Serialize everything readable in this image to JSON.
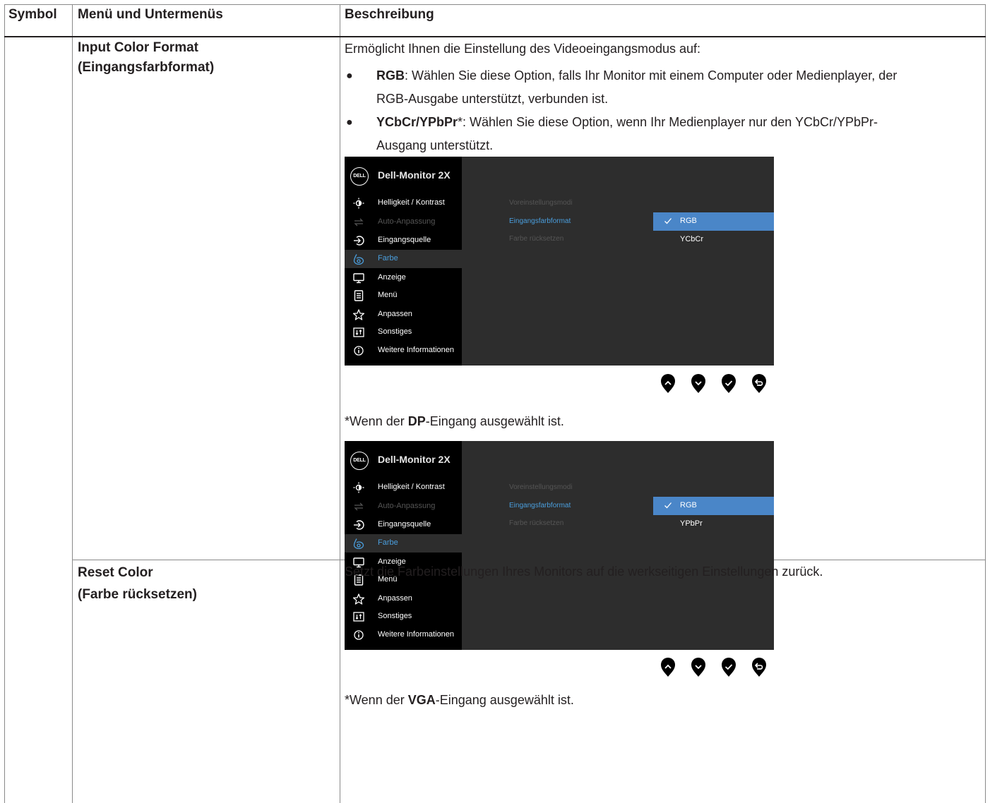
{
  "header": {
    "symbol": "Symbol",
    "menu": "Menü und Untermenüs",
    "description": "Beschreibung"
  },
  "row1": {
    "title_line1": "Input Color Format",
    "title_line2": "(Eingangsfarbformat)",
    "intro": "Ermöglicht Ihnen die Einstellung des Videoeingangsmodus auf:",
    "bullet1_bold": "RGB",
    "bullet1_line1": ": Wählen Sie diese Option, falls Ihr Monitor mit einem Computer oder Medienplayer, der",
    "bullet1_line2": "RGB-Ausgabe unterstützt, verbunden ist.",
    "bullet2_bold": "YCbCr/YPbPr",
    "bullet2_line1": "*: Wählen Sie diese Option, wenn Ihr Medienplayer nur den YCbCr/YPbPr-",
    "bullet2_line2": "Ausgang unterstützt.",
    "note1_prefix": "*Wenn der ",
    "note1_bold": "DP",
    "note1_suffix": "-Eingang ausgewählt ist.",
    "note2_prefix": "*Wenn der ",
    "note2_bold": "VGA",
    "note2_suffix": "-Eingang ausgewählt ist."
  },
  "row2": {
    "title_line1": "Reset Color",
    "title_line2": "(Farbe rücksetzen)",
    "desc": "Setzt die Farbeinstellungen Ihres Monitors auf die werkseitigen Einstellungen zurück."
  },
  "osd": {
    "logo": "DELL",
    "title": "Dell-Monitor 2X",
    "menu": [
      {
        "label": "Helligkeit / Kontrast",
        "icon": "brightness-icon"
      },
      {
        "label": "Auto-Anpassung",
        "icon": "auto-adjust-icon"
      },
      {
        "label": "Eingangsquelle",
        "icon": "input-source-icon"
      },
      {
        "label": "Farbe",
        "icon": "color-icon"
      },
      {
        "label": "Anzeige",
        "icon": "display-icon"
      },
      {
        "label": "Menü",
        "icon": "menu-icon"
      },
      {
        "label": "Anpassen",
        "icon": "star-icon"
      },
      {
        "label": "Sonstiges",
        "icon": "others-icon"
      },
      {
        "label": "Weitere Informationen",
        "icon": "info-icon"
      }
    ],
    "submenu": [
      "Voreinstellungsmodi",
      "Eingangsfarbformat",
      "Farbe rücksetzen"
    ],
    "options_dp": [
      "RGB",
      "YCbCr"
    ],
    "options_vga": [
      "RGB",
      "YPbPr"
    ],
    "colors": {
      "accent": "#4a86c8",
      "highlight_text": "#4a9edd",
      "panel": "#2d2d2d",
      "sidebar": "#000000"
    }
  }
}
